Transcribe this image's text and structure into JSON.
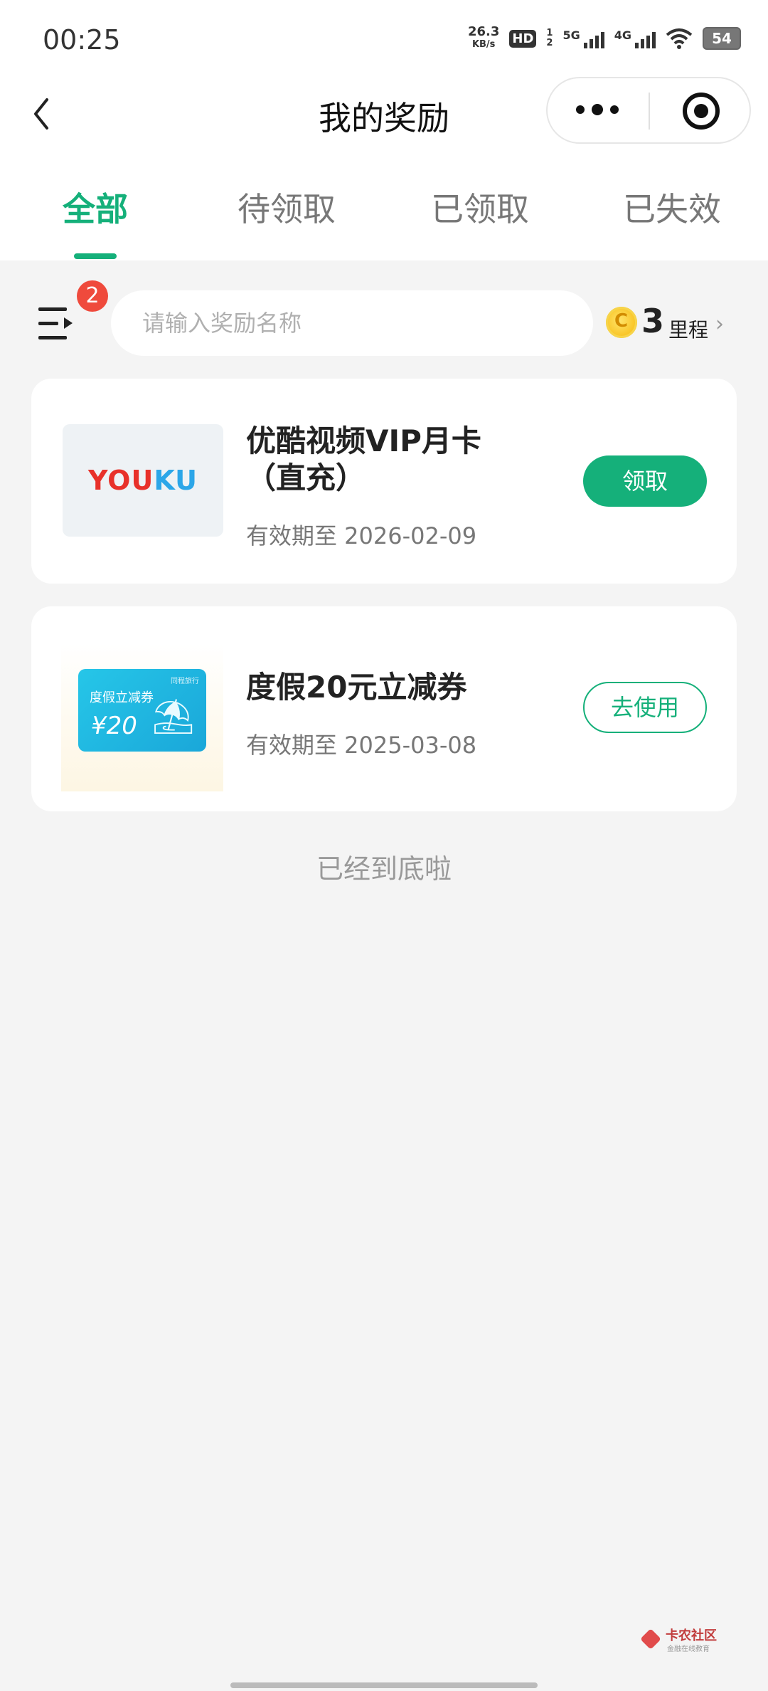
{
  "status_bar": {
    "time": "00:25",
    "net_speed": "26.3",
    "net_unit": "KB/s",
    "hd": "HD",
    "sim1": "1",
    "sim2": "2",
    "signal1": "5G",
    "signal2": "4G",
    "battery": "54"
  },
  "header": {
    "title": "我的奖励"
  },
  "tabs": [
    {
      "label": "全部",
      "active": true
    },
    {
      "label": "待领取",
      "active": false
    },
    {
      "label": "已领取",
      "active": false
    },
    {
      "label": "已失效",
      "active": false
    }
  ],
  "toolbar": {
    "filter_badge": "2",
    "search_placeholder": "请输入奖励名称",
    "miles_value": "3",
    "miles_unit": "里程"
  },
  "rewards": [
    {
      "logo_text_1": "YOU",
      "logo_text_2": "KU",
      "name_line1": "优酷视频VIP月卡",
      "name_line2": "（直充）",
      "expiry": "有效期至 2026-02-09",
      "action": "领取"
    },
    {
      "coupon_label": "度假立减券",
      "coupon_amount": "¥20",
      "coupon_brand": "同程旅行",
      "name_line1": "度假20元立减券",
      "expiry": "有效期至 2025-03-08",
      "action": "去使用"
    }
  ],
  "footer": {
    "end_note": "已经到底啦",
    "watermark_title": "卡农社区",
    "watermark_sub": "金融在线教育"
  },
  "colors": {
    "accent": "#15b07a",
    "badge": "#ef4a3c",
    "background": "#f4f4f4"
  }
}
